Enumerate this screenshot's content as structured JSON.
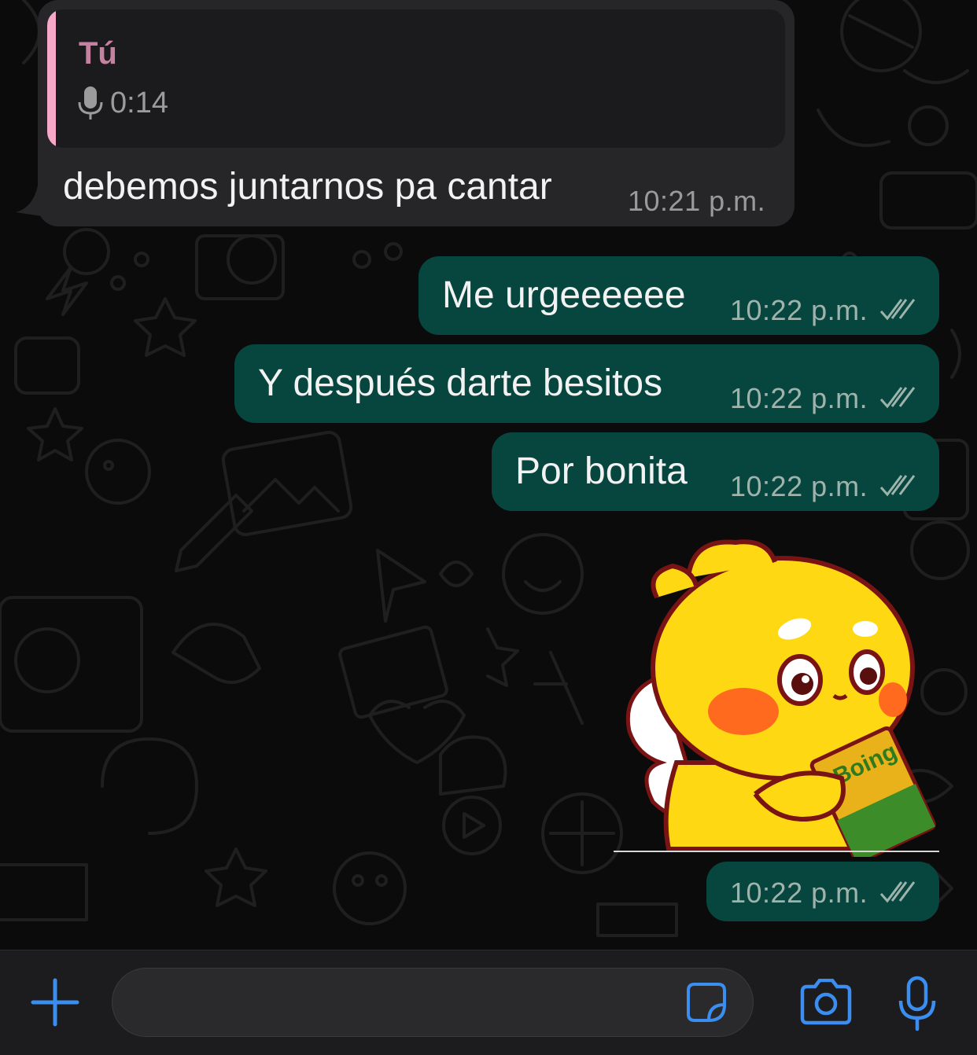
{
  "chat": {
    "messages": [
      {
        "direction": "incoming",
        "quoted": {
          "author": "Tú",
          "icon": "mic-icon",
          "duration": "0:14"
        },
        "text": "debemos juntarnos pa cantar",
        "time": "10:21 p.m."
      },
      {
        "direction": "outgoing",
        "text": "Me urgeeeeee",
        "time": "10:22 p.m.",
        "status": "read"
      },
      {
        "direction": "outgoing",
        "text": "Y después darte besitos",
        "time": "10:22 p.m.",
        "status": "read"
      },
      {
        "direction": "outgoing",
        "text": "Por bonita",
        "time": "10:22 p.m.",
        "status": "read"
      },
      {
        "direction": "outgoing",
        "type": "sticker",
        "sticker_text": "Boing",
        "time": "10:22 p.m.",
        "status": "read"
      }
    ]
  },
  "input_bar": {
    "attach_icon": "plus-icon",
    "sticker_icon": "sticker-icon",
    "camera_icon": "camera-icon",
    "mic_icon": "mic-icon",
    "composer_value": ""
  },
  "colors": {
    "incoming_bubble": "#262628",
    "outgoing_bubble": "#07463e",
    "accent_blue": "#3b8ef0",
    "quote_bar": "#f5a8c8",
    "quote_author": "#c481a0"
  }
}
